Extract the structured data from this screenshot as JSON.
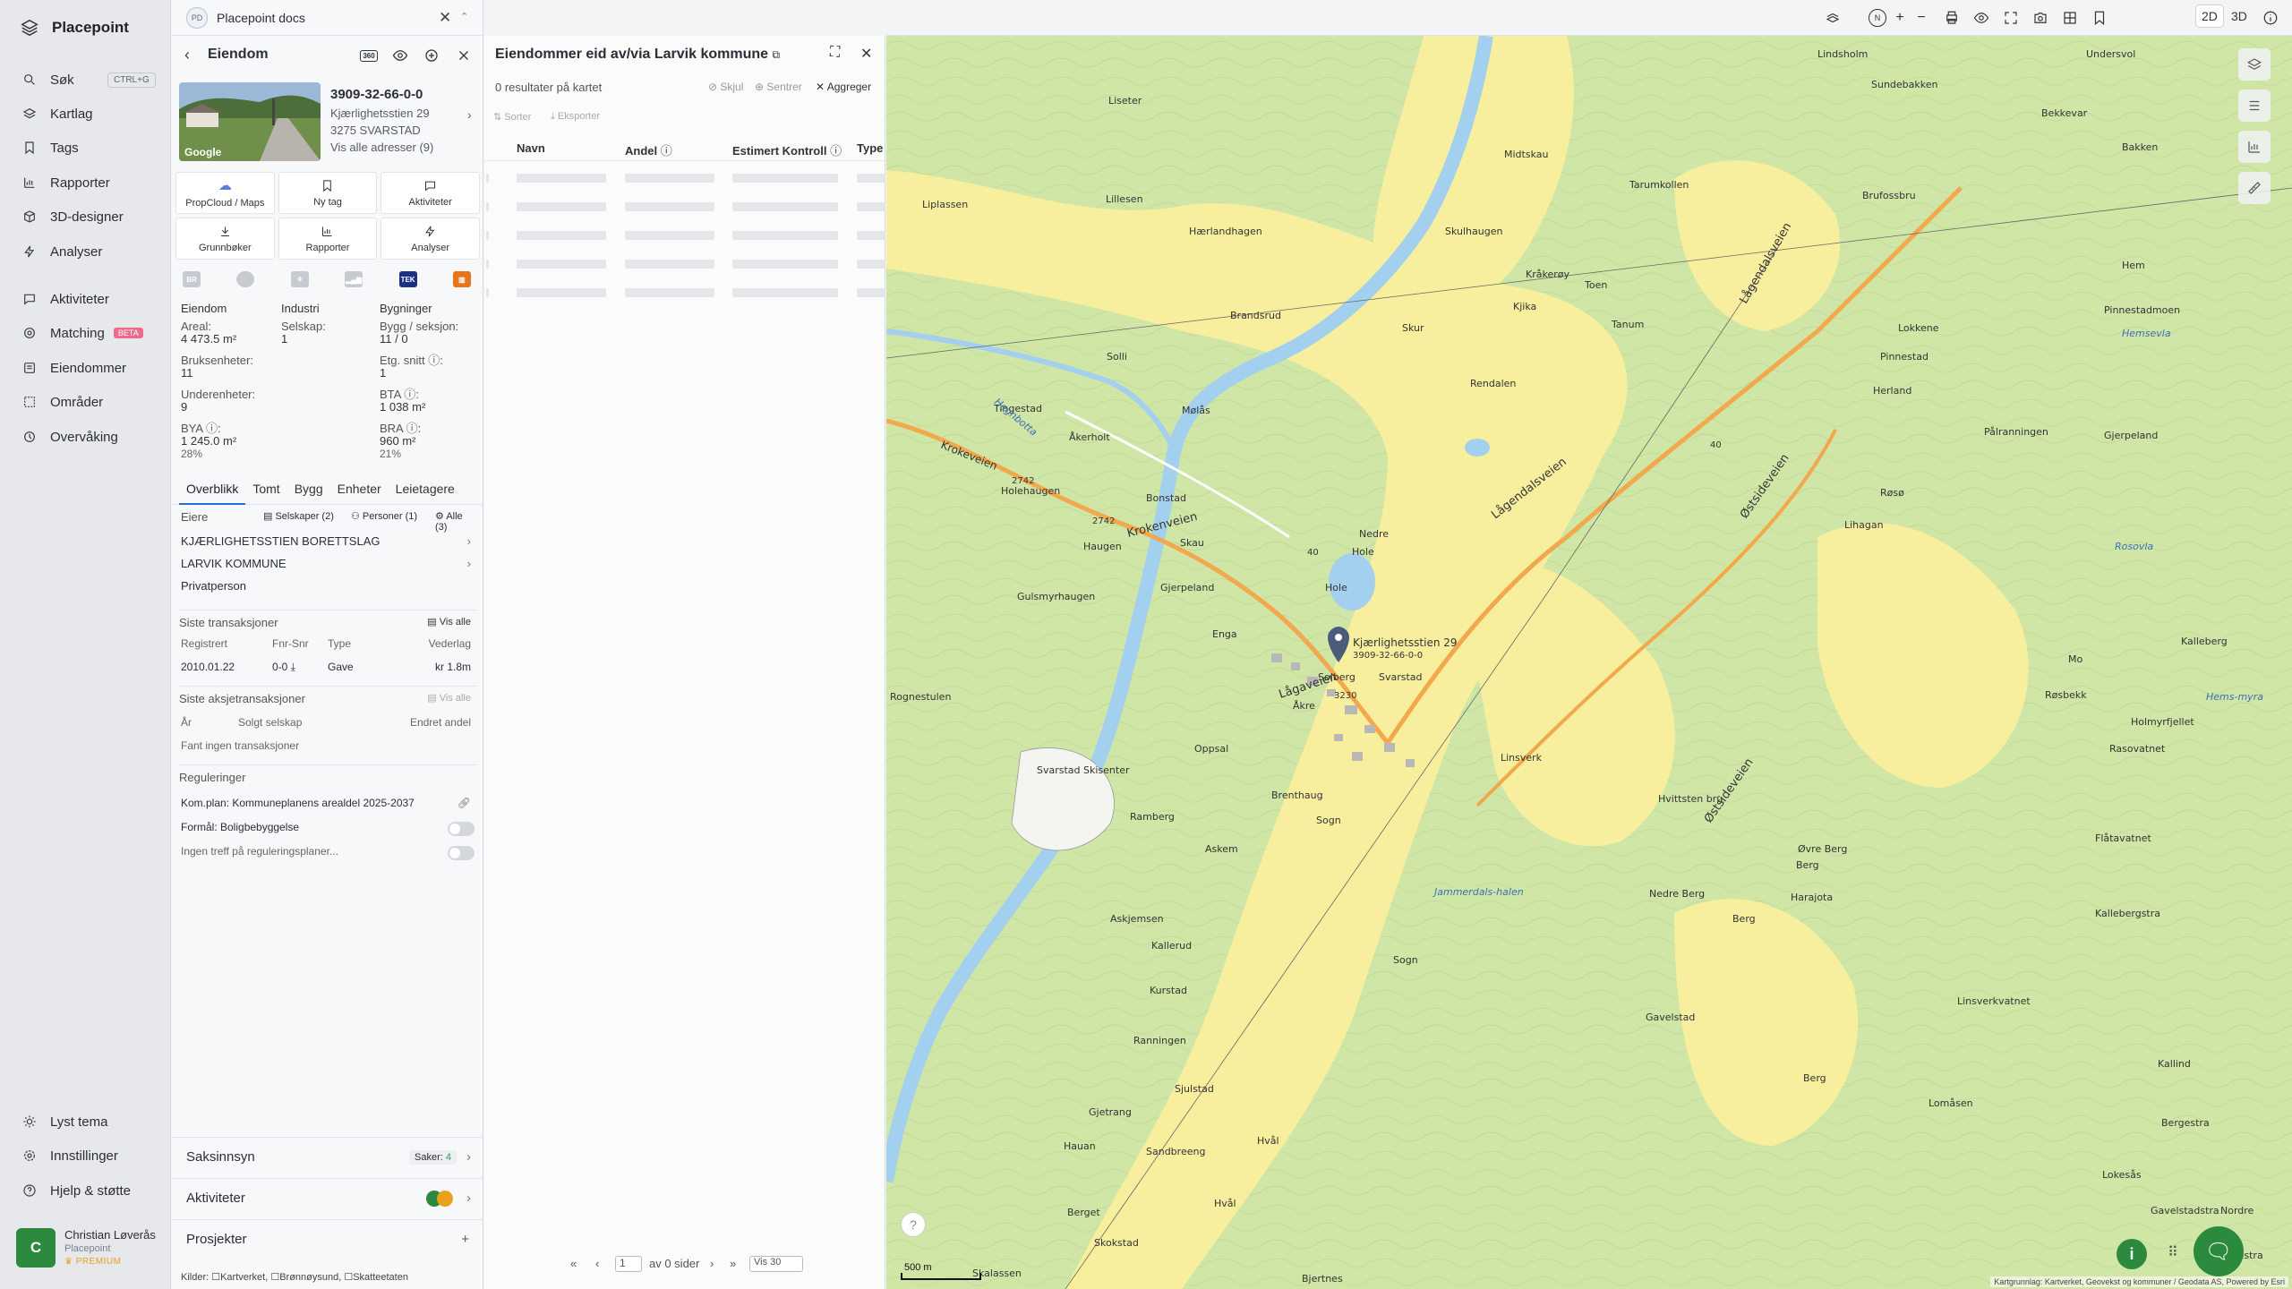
{
  "app": {
    "name": "Placepoint"
  },
  "nav": {
    "items": [
      {
        "label": "Søk",
        "icon": "search-icon",
        "shortcut": "CTRL+G"
      },
      {
        "label": "Kartlag",
        "icon": "layers-icon"
      },
      {
        "label": "Tags",
        "icon": "bookmark-icon"
      },
      {
        "label": "Rapporter",
        "icon": "chart-icon"
      },
      {
        "label": "3D-designer",
        "icon": "cube-icon"
      },
      {
        "label": "Analyser",
        "icon": "bolt-icon"
      },
      {
        "label": "Aktiviteter",
        "icon": "chat-icon"
      },
      {
        "label": "Matching",
        "icon": "target-icon",
        "badge": "BETA"
      },
      {
        "label": "Eiendommer",
        "icon": "list-icon"
      },
      {
        "label": "Områder",
        "icon": "area-icon"
      },
      {
        "label": "Overvåking",
        "icon": "watch-icon"
      }
    ],
    "bottom": [
      {
        "label": "Lyst tema",
        "icon": "sun-icon"
      },
      {
        "label": "Innstillinger",
        "icon": "gear-icon"
      },
      {
        "label": "Hjelp & støtte",
        "icon": "help-icon"
      }
    ],
    "user": {
      "initial": "C",
      "name": "Christian Løverås",
      "org": "Placepoint",
      "plan": "PREMIUM"
    }
  },
  "docs": {
    "badge": "PD",
    "title": "Placepoint docs"
  },
  "property": {
    "header": "Eiendom",
    "badge360": "360",
    "id": "3909-32-66-0-0",
    "street": "Kjærlighetsstien 29",
    "postal": "3275 SVARSTAD",
    "all_addresses": "Vis alle adresser (9)",
    "photo_credit": "Google",
    "actions": [
      {
        "label": "PropCloud / Maps",
        "icon": "cloud-icon"
      },
      {
        "label": "Ny tag",
        "icon": "bookmark-icon"
      },
      {
        "label": "Aktiviteter",
        "icon": "chat-icon"
      },
      {
        "label": "Grunnbøker",
        "icon": "download-icon"
      },
      {
        "label": "Rapporter",
        "icon": "chart-icon"
      },
      {
        "label": "Analyser",
        "icon": "bolt-icon"
      }
    ],
    "sources": [
      "BR",
      "TEK"
    ],
    "facts": {
      "col1_title": "Eiendom",
      "areal_label": "Areal:",
      "areal": "4 473.5 m²",
      "bruksenheter_label": "Bruksenheter:",
      "bruksenheter": "11",
      "underenheter_label": "Underenheter:",
      "underenheter": "9",
      "bya_label": "BYA ⓘ:",
      "bya": "1 245.0 m²",
      "bya_pct": "28%",
      "col2_title": "Industri",
      "selskap_label": "Selskap:",
      "selskap": "1",
      "col3_title": "Bygninger",
      "bygg_label": "Bygg / seksjon:",
      "bygg": "11 / 0",
      "etg_label": "Etg. snitt ⓘ:",
      "etg": "1",
      "bta_label": "BTA ⓘ:",
      "bta": "1 038  m²",
      "bra_label": "BRA ⓘ:",
      "bra": "960 m²",
      "bra_pct": "21%"
    },
    "tabs": [
      "Overblikk",
      "Tomt",
      "Bygg",
      "Enheter",
      "Leietagere"
    ],
    "owners": {
      "label": "Eiere",
      "filters": [
        "Selskaper (2)",
        "Personer (1)",
        "Alle (3)"
      ],
      "list": [
        "KJÆRLIGHETSSTIEN BORETTSLAG",
        "LARVIK KOMMUNE",
        "Privatperson"
      ]
    },
    "transactions": {
      "label": "Siste transaksjoner",
      "show_all": "Vis alle",
      "cols": [
        "Registrert",
        "Fnr-Snr",
        "Type",
        "Vederlag"
      ],
      "rows": [
        [
          "2010.01.22",
          "0-0",
          "Gave",
          "kr 1.8m"
        ]
      ]
    },
    "share_tx": {
      "label": "Siste aksjetransaksjoner",
      "show_all": "Vis alle",
      "cols": [
        "År",
        "Solgt selskap",
        "Endret andel"
      ],
      "empty": "Fant ingen transaksjoner"
    },
    "regulations": {
      "label": "Reguleringer",
      "plan": "Kom.plan: Kommuneplanens arealdel 2025-2037",
      "purpose": "Formål: Boligbebyggelse",
      "none": "Ingen treff på reguleringsplaner..."
    },
    "accordions": [
      {
        "label": "Saksinnsyn",
        "meta_label": "Saker:",
        "meta_value": "4"
      },
      {
        "label": "Aktiviteter"
      },
      {
        "label": "Prosjekter"
      }
    ],
    "sources_footer": "Kilder: ☐Kartverket, ☐Brønnøysund, ☐Skatteetaten"
  },
  "owned": {
    "title": "Eiendommer eid av/via Larvik kommune",
    "count": "0 resultater på kartet",
    "hide": "Skjul",
    "center": "Sentrer",
    "aggregate": "Aggreger",
    "sort": "Sorter",
    "export": "Eksporter",
    "columns": [
      "Navn",
      "Andel",
      "Estimert Kontroll",
      "Type"
    ],
    "pager": {
      "page": "1",
      "of": "av 0 sider",
      "per_page": "Vis 30"
    }
  },
  "map": {
    "toolbar": {
      "north": "N",
      "mode_2d": "2D",
      "mode_3d": "3D"
    },
    "scale": "500 m",
    "attribution": "Kartgrunnlag: Kartverket, Geovekst og kommuner / Geodata AS, Powered by Esri",
    "marker_label": "Kjærlighetsstien 29",
    "marker_sub": "3909-32-66-0-0",
    "roads": [
      "Krokeveien",
      "Krokenveien",
      "Lågendalsveien",
      "Lågendalsveien",
      "Østsideveien",
      "Østsideveien",
      "Lågaveien"
    ],
    "road_numbers": [
      "2742",
      "2742",
      "40",
      "40",
      "3230"
    ],
    "places": [
      "Undersvol",
      "Lindsholm",
      "Sundebakken",
      "Bekkevar",
      "Liseter",
      "Midtskau",
      "Tarumkollen",
      "Brufossbru",
      "Bakken",
      "Lillesen",
      "Skulhaugen",
      "Kråkerøy",
      "Hem",
      "Liplassen",
      "Hærlandhagen",
      "Kjika",
      "Toen",
      "Pinnestadmoen",
      "Tanum",
      "Lokkene",
      "Brandsrud",
      "Skur",
      "Pinnestad",
      "Solli",
      "Rendalen",
      "Herland",
      "Pålranningen",
      "Tingestad",
      "Mølås",
      "Åkerholt",
      "Lihagan",
      "Røsø",
      "Holehaugen",
      "Bonstad",
      "Skau",
      "Gjerpeland",
      "Haugen",
      "Nedre",
      "Hole",
      "Gulsmyrhaugen",
      "Gjerpeland",
      "Hole",
      "Enga",
      "Kalleberg",
      "Solberg",
      "Svarstad",
      "Mo",
      "Rognestulen",
      "Åkre",
      "Røsbekk",
      "Holmyrfjellet",
      "Svarstad Skisenter",
      "Oppsal",
      "Linsverk",
      "Rasovatnet",
      "Brenthaug",
      "Hvittsten bru",
      "Ramberg",
      "Sogn",
      "Øvre Berg",
      "Askem",
      "Berg",
      "Flåtavatnet",
      "Nedre Berg",
      "Askjemsen",
      "Harajota",
      "Berg",
      "Kallebergstra",
      "Kallerud",
      "Sogn",
      "Kurstad",
      "Linsverkvatnet",
      "Gavelstad",
      "Ranningen",
      "Lomåsen",
      "Sjulstad",
      "Kallind",
      "Berg",
      "Gjetrang",
      "Bergestra",
      "Hauan",
      "Sandbreeng",
      "Hvål",
      "Lokesås",
      "Hvål",
      "Berget",
      "Nordre",
      "Skokstad",
      "Gavelstadstra",
      "Skalassen",
      "Bjertnes",
      "Bergestra"
    ],
    "water": [
      "Jammerdals-halen",
      "Hemsevla",
      "Hems-myra",
      "Rosovla",
      "Hegnbotta"
    ]
  }
}
